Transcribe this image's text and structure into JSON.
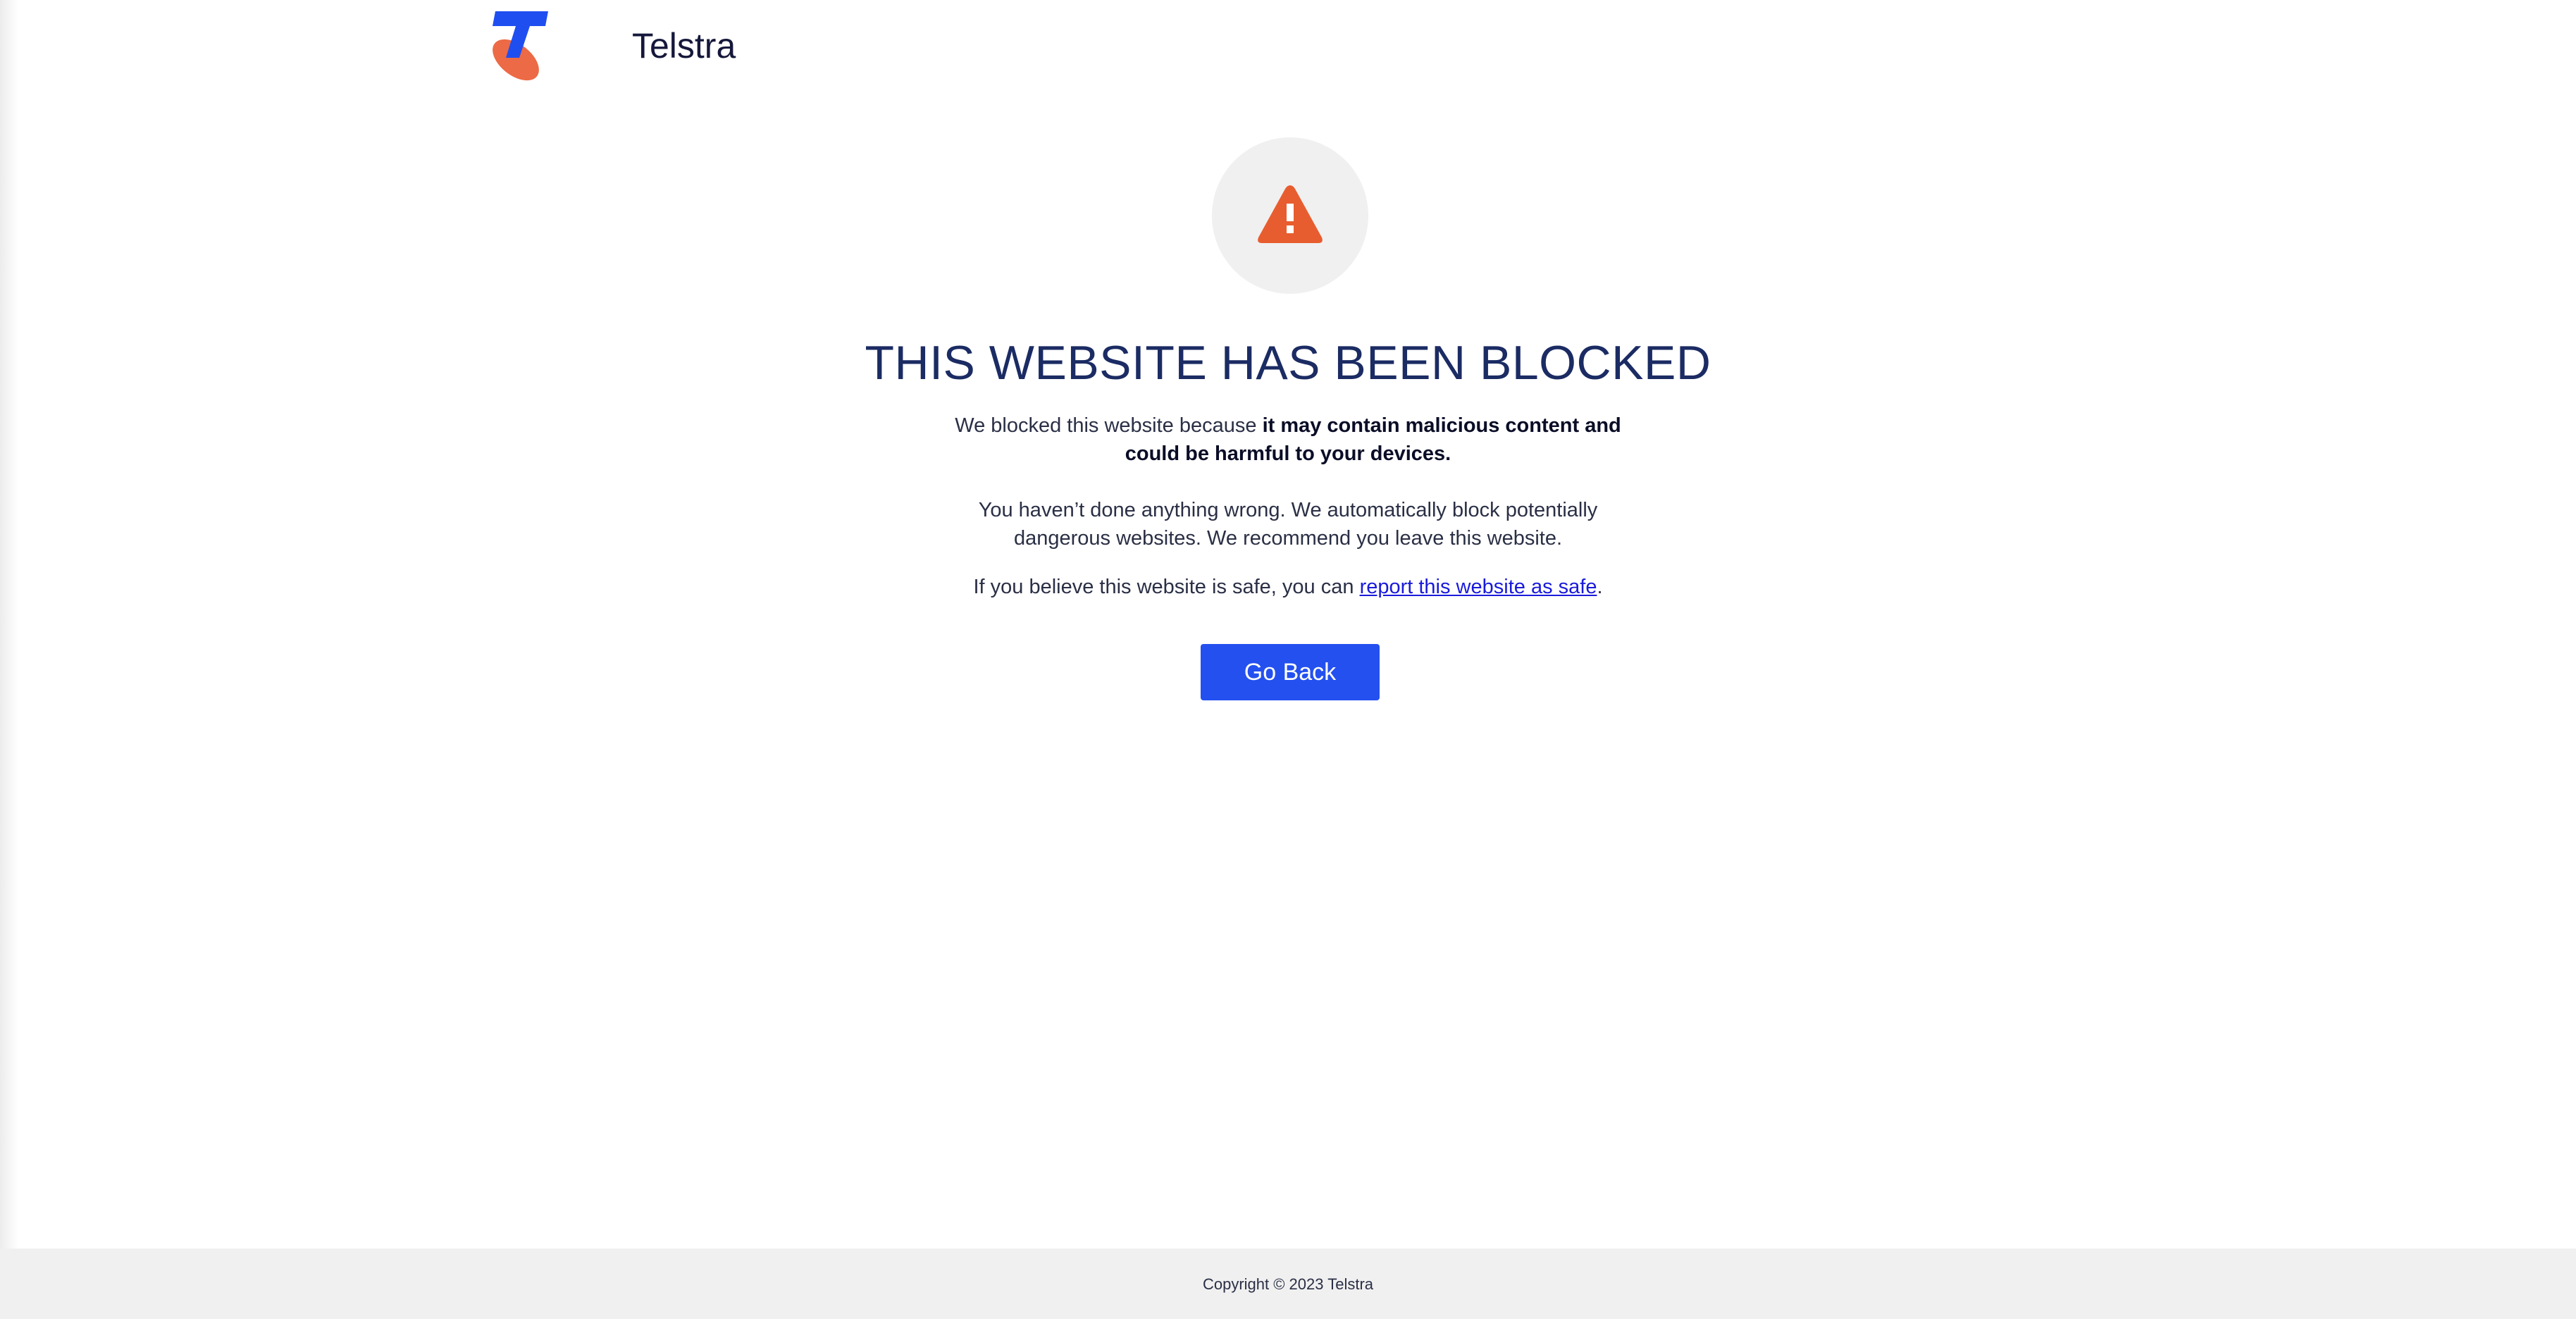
{
  "header": {
    "brand_name": "Telstra",
    "logo_icon": "telstra-logo-icon",
    "colors": {
      "logo_blue": "#1f4ef0",
      "logo_orange": "#ec6a45"
    }
  },
  "warning": {
    "icon": "warning-triangle-icon",
    "icon_color": "#e85d2f",
    "circle_color": "#f0f0f0"
  },
  "main": {
    "title": "THIS WEBSITE HAS BEEN BLOCKED",
    "reason_prefix": "We blocked this website because ",
    "reason_bold": "it may contain malicious content and could be harmful to your devices.",
    "reassurance": "You haven’t done anything wrong. We automatically block potentially dangerous websites. We recommend you leave this website.",
    "report_prefix": "If you believe this website is safe, you can ",
    "report_link": "report this website as safe",
    "report_suffix": ".",
    "go_back_label": "Go Back",
    "button_color": "#2450f0",
    "title_color": "#1b2b63"
  },
  "footer": {
    "copyright": "Copyright © 2023 Telstra"
  }
}
